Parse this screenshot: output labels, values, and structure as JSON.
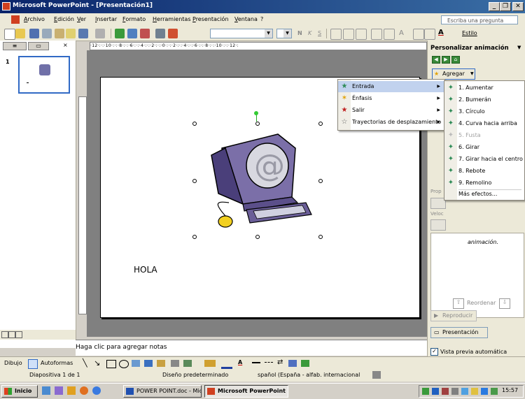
{
  "window": {
    "title": "Microsoft PowerPoint - [Presentación1]",
    "minimize_glyph": "_",
    "restore_glyph": "❐",
    "close_glyph": "✕",
    "doc_close_glyph": "✕"
  },
  "menubar": {
    "items": [
      "Archivo",
      "Edición",
      "Ver",
      "Insertar",
      "Formato",
      "Herramientas",
      "Presentación",
      "Ventana",
      "?"
    ],
    "ask_placeholder": "Escriba una pregunta"
  },
  "toolbar": {
    "style_label": "Estilo"
  },
  "leftpane": {
    "tabs": [
      "≡",
      "▭",
      "×"
    ],
    "slide_number": "1"
  },
  "ruler": {
    "label": "·12·:·:·10·:·:·8·:·:·6·:·:·4·:·:·2·:·:·0·:·:·2·:·:·4·:·:·6·:·:·8·:·:·10·:·:·12·:"
  },
  "slide": {
    "text": "HOLA"
  },
  "notes": {
    "placeholder": "Haga clic para agregar notas"
  },
  "taskpane": {
    "title": "Personalizar animación",
    "add_effect": "Agregar efecto",
    "hint_text": "animación.",
    "reorder_label": "Reordenar",
    "play_label": "Reproducir",
    "slideshow_label": "Presentación",
    "autopreview_label": "Vista previa automática",
    "autopreview_checked": true,
    "truncated_labels": [
      "Prop",
      "Veloc"
    ]
  },
  "effect_menu": {
    "items": [
      {
        "label": "Entrada",
        "selected": true
      },
      {
        "label": "Énfasis"
      },
      {
        "label": "Salir"
      },
      {
        "label": "Trayectorias de desplazamiento"
      }
    ]
  },
  "entrance_menu": {
    "items": [
      {
        "label": "1. Aumentar"
      },
      {
        "label": "2. Bumerán"
      },
      {
        "label": "3. Círculo"
      },
      {
        "label": "4. Curva hacia arriba"
      },
      {
        "label": "5. Fusta",
        "disabled": true
      },
      {
        "label": "6. Girar"
      },
      {
        "label": "7. Girar hacia el centro"
      },
      {
        "label": "8. Rebote"
      },
      {
        "label": "9. Remolino"
      }
    ],
    "more": "Más efectos..."
  },
  "drawbar": {
    "draw_label": "Dibujo",
    "autoshapes_label": "Autoformas"
  },
  "status": {
    "slide": "Diapositiva 1 de 1",
    "design": "Diseño predeterminado",
    "language": "spañol (España - alfab. internacional"
  },
  "taskbar": {
    "start": "Inicio",
    "buttons": [
      "POWER POINT.doc - Micr...",
      "Microsoft PowerPoint ..."
    ],
    "clock": "15:57"
  },
  "colors": {
    "title_bar": "#0a246a",
    "menu_highlight": "#c1d2ee",
    "workspace": "#808080",
    "icon_green": "#2e8b57"
  }
}
